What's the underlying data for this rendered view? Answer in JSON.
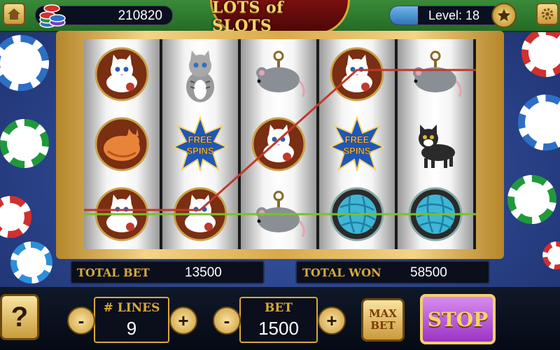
{
  "header": {
    "coins": "210820",
    "title": "LOTS of SLOTS",
    "level_label": "Level: 18",
    "level_progress": 0.25
  },
  "icons": {
    "menu": "home-icon",
    "star": "star-icon",
    "settings": "gear-icon",
    "chips": "chip-stack-icon"
  },
  "reels": [
    [
      "white-cat",
      "orange-cat",
      "white-cat"
    ],
    [
      "gray-tabby-cat",
      "free-spins",
      "white-cat"
    ],
    [
      "wind-up-mouse",
      "white-cat",
      "wind-up-mouse"
    ],
    [
      "white-cat",
      "free-spins",
      "yarn-ball"
    ],
    [
      "wind-up-mouse",
      "black-cat",
      "yarn-ball"
    ]
  ],
  "symbols": {
    "free_spins_line1": "FREE",
    "free_spins_line2": "SPINS"
  },
  "paylines": [
    {
      "color": "#c0392b",
      "rows": [
        2,
        2,
        1,
        0,
        0
      ]
    },
    {
      "color": "#7bc02a",
      "rows": [
        2,
        2,
        2,
        2,
        2
      ]
    }
  ],
  "info": {
    "total_bet_label": "TOTAL BET",
    "total_bet_value": "13500",
    "total_won_label": "TOTAL WON",
    "total_won_value": "58500"
  },
  "controls": {
    "help_label": "?",
    "lines_label": "# LINES",
    "lines_value": "9",
    "bet_label": "BET",
    "bet_value": "1500",
    "minus": "-",
    "plus": "+",
    "max_bet_label_1": "MAX",
    "max_bet_label_2": "BET",
    "stop_label": "STOP"
  },
  "colors": {
    "gold": "#d9a93a",
    "stop_purple": "#b44fd6",
    "felt_blue": "#2a438a",
    "topbar_green": "#2f7a2f"
  }
}
